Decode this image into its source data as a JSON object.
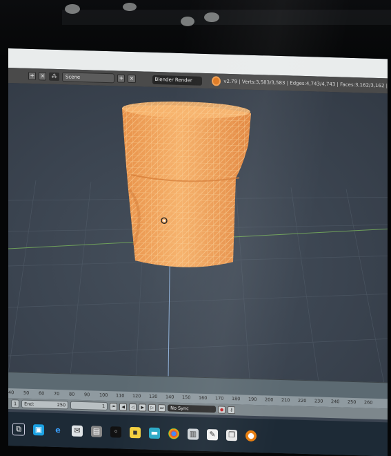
{
  "header": {
    "scene_label": "Scene",
    "render_engine": "Blender Render",
    "stats": "v2.79 | Verts:3,583/3,583 | Edges:4,743/4,743 | Faces:3,162/3,162 |"
  },
  "timeline": {
    "ruler_ticks": [
      "40",
      "50",
      "60",
      "70",
      "80",
      "90",
      "100",
      "110",
      "120",
      "130",
      "140",
      "150",
      "160",
      "170",
      "180",
      "190",
      "200",
      "210",
      "220",
      "230",
      "240",
      "250",
      "260"
    ],
    "start_value": "1",
    "end_label": "End:",
    "end_value": "250",
    "current_frame": "1",
    "sync_mode": "No Sync"
  },
  "taskbar": {
    "icons": [
      "task-view-icon",
      "store-icon",
      "edge-icon",
      "mail-icon",
      "explorer-icon",
      "media-icon",
      "sticky-notes-icon",
      "app-icon",
      "chrome-icon",
      "camera-icon",
      "notes-icon",
      "files-icon",
      "blender-icon"
    ]
  },
  "colors": {
    "mesh": "#f2a35a",
    "mesh_wire": "#fbd39a",
    "grid_x_axis": "#6fa05a",
    "grid_y_axis": "#8fb0d8",
    "viewport_bg": "#3b4450"
  }
}
